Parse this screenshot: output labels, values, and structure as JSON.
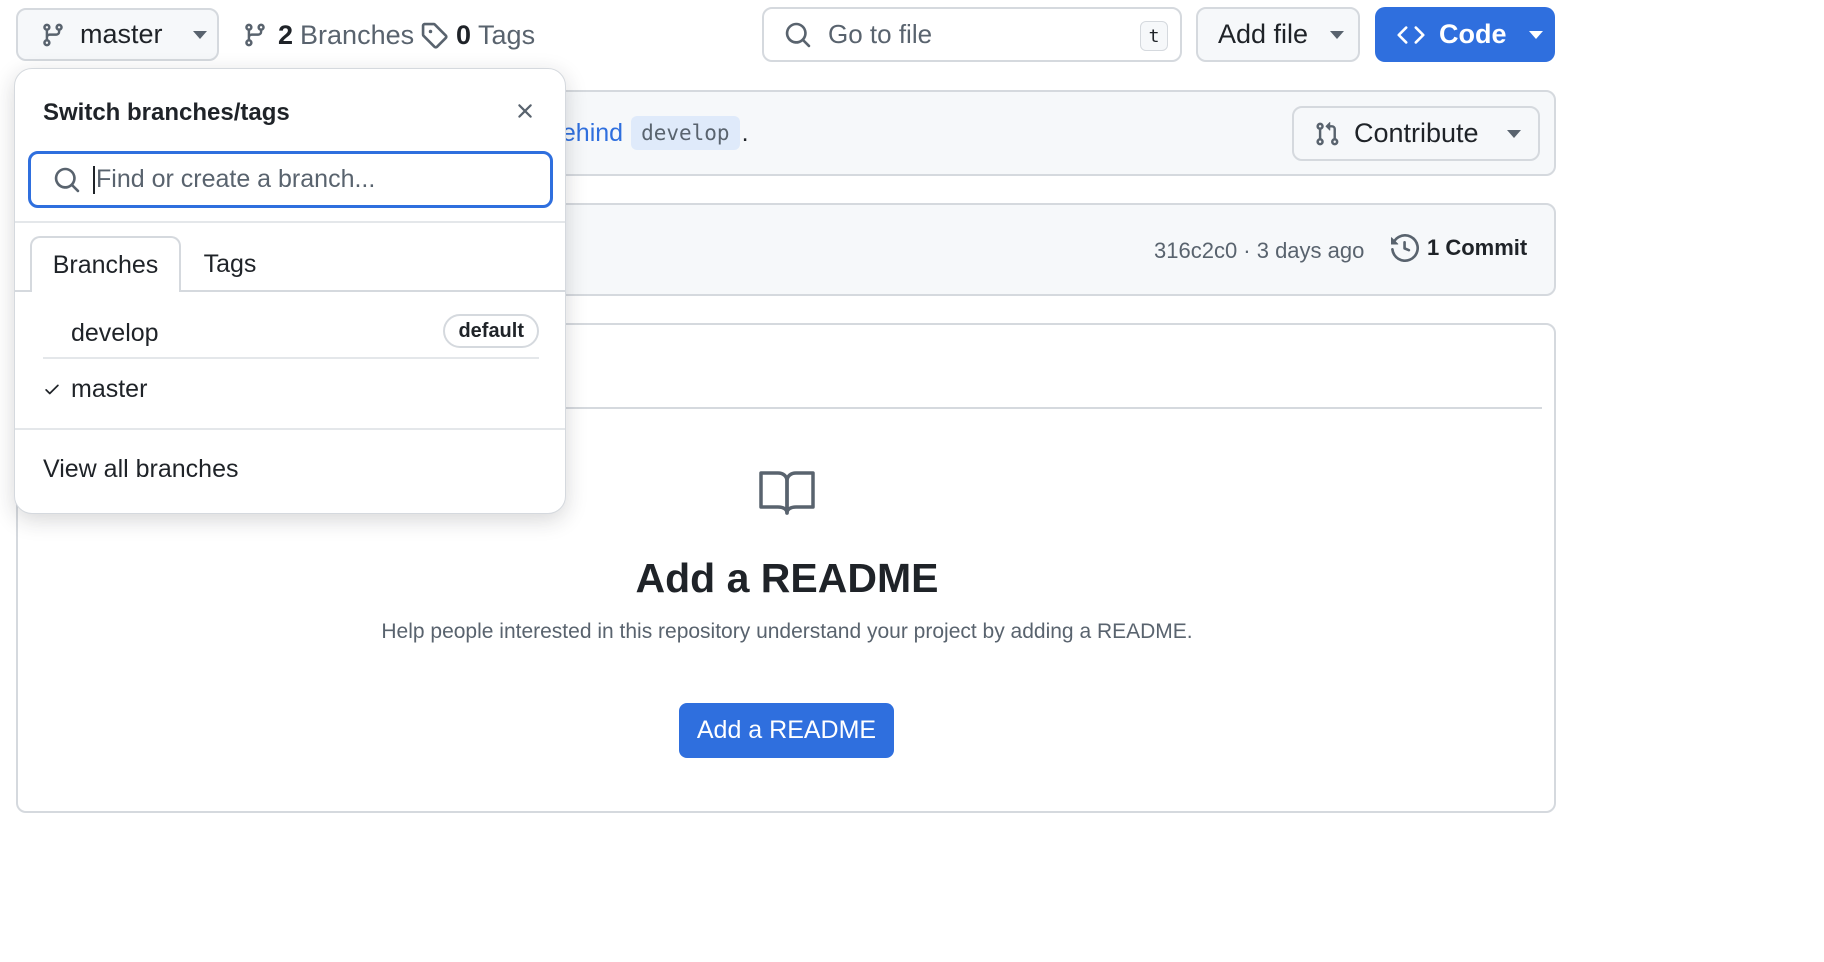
{
  "topbar": {
    "branch_button": "master",
    "branches_count": "2",
    "branches_label": "Branches",
    "tags_count": "0",
    "tags_label": "Tags",
    "goto_placeholder": "Go to file",
    "goto_shortcut": "t",
    "add_file_label": "Add file",
    "code_label": "Code"
  },
  "compare_banner": {
    "link_text": "behind",
    "branch_chip": "develop",
    "tail": ".",
    "contribute_label": "Contribute"
  },
  "commit_bar": {
    "sha_and_time": "316c2c0 · 3 days ago",
    "commit_count_label": "1 Commit"
  },
  "readme_empty": {
    "title": "Add a README",
    "description": "Help people interested in this repository understand your project by adding a README.",
    "button_label": "Add a README"
  },
  "branch_dropdown": {
    "title": "Switch branches/tags",
    "filter_placeholder": "Find or create a branch...",
    "tabs": [
      {
        "label": "Branches",
        "selected": true
      },
      {
        "label": "Tags",
        "selected": false
      }
    ],
    "branches": [
      {
        "name": "develop",
        "badge": "default",
        "checked": false
      },
      {
        "name": "master",
        "badge": "",
        "checked": true
      }
    ],
    "view_all_label": "View all branches"
  },
  "colors": {
    "accent": "#2f6fde",
    "border": "#d5d9de",
    "muted_text": "#59636e",
    "focus_ring": "#2f6fde"
  }
}
